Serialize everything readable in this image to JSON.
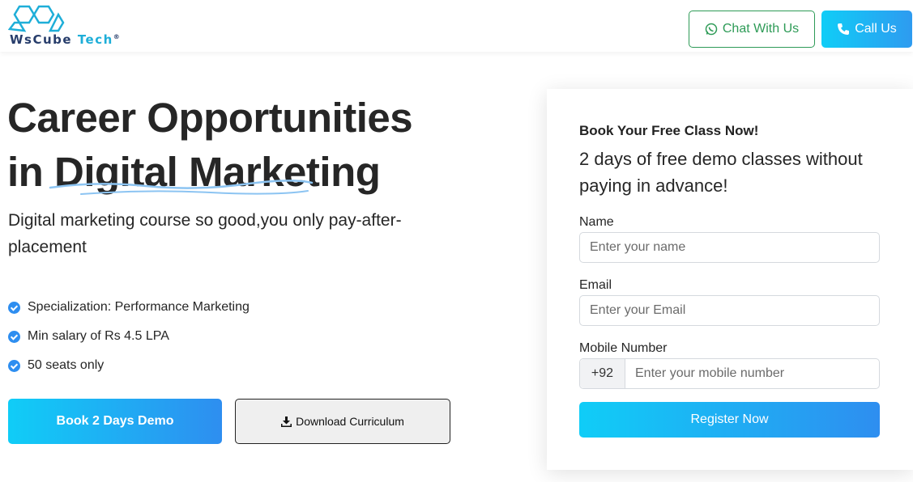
{
  "brand": {
    "name_part1": "WsCube",
    "name_part2": "Tech",
    "registered": "®"
  },
  "header": {
    "chat_label": "Chat With Us",
    "call_label": "Call Us"
  },
  "hero": {
    "title_line1": "Career Opportunities",
    "title_line2": "in Digital Marketing",
    "subtitle": "Digital marketing course so good,you only pay-after-placement",
    "features": [
      "Specialization: Performance Marketing",
      "Min salary of Rs 4.5 LPA",
      "50 seats only"
    ],
    "demo_button": "Book 2 Days Demo",
    "download_button": "Download Curriculum"
  },
  "form": {
    "title": "Book Your Free Class Now!",
    "subtitle": "2 days of free demo classes without paying in advance!",
    "name_label": "Name",
    "name_placeholder": "Enter your name",
    "email_label": "Email",
    "email_placeholder": "Enter your Email",
    "mobile_label": "Mobile Number",
    "country_code": "+92",
    "mobile_placeholder": "Enter your mobile number",
    "submit_label": "Register Now"
  },
  "colors": {
    "accent_start": "#10cdf7",
    "accent_end": "#2e8ef0",
    "whatsapp_green": "#2e9b57",
    "brand_navy": "#273d6b"
  }
}
